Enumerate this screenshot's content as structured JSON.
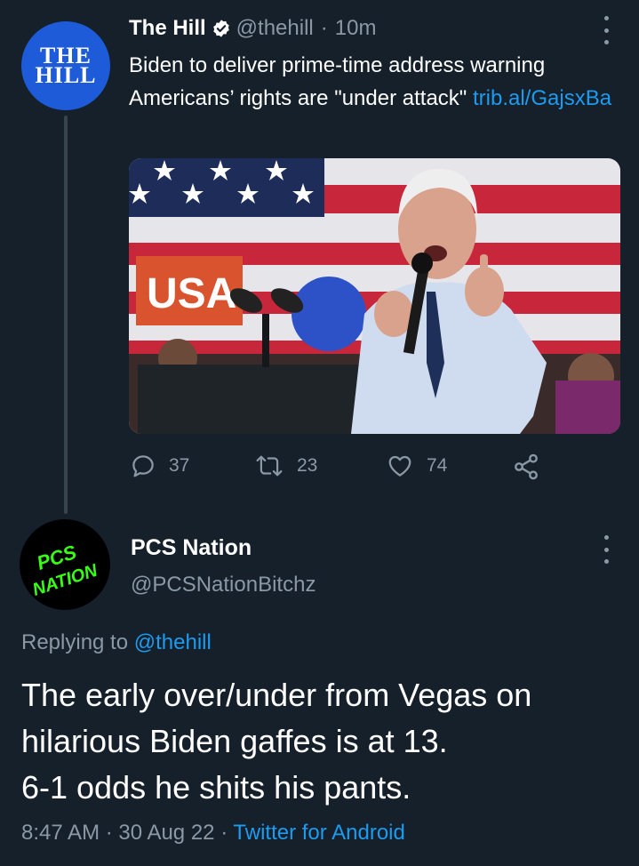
{
  "parent_tweet": {
    "avatar": {
      "line1": "THE",
      "line2": "HILL"
    },
    "author_name": "The Hill",
    "handle": "@thehill",
    "separator": "·",
    "time_ago": "10m",
    "text": "Biden to deliver prime-time address warning Americans’ rights are \"under attack\"",
    "link_text": "trib.al/GajsxBa",
    "media_alt": "Photo of Joe Biden speaking at a podium with an American flag behind him",
    "media_sign_text": "USA",
    "actions": {
      "replies": "37",
      "retweets": "23",
      "likes": "74"
    }
  },
  "reply_tweet": {
    "avatar_text": {
      "line1": "PCS",
      "line2": "NATION"
    },
    "author_name": "PCS Nation",
    "handle": "@PCSNationBitchz",
    "replying_label": "Replying to",
    "replying_handle": "@thehill",
    "body_lines": [
      "The early over/under from Vegas on",
      "hilarious Biden gaffes is at 13.",
      "6-1 odds he shits his pants."
    ],
    "time": "8:47 AM",
    "date": "30 Aug 22",
    "dot": "·",
    "source": "Twitter for Android"
  },
  "colors": {
    "background": "#15202b",
    "text": "#ffffff",
    "muted": "#8b98a5",
    "link": "#1d9bf0",
    "hill_blue": "#1d5bd8",
    "pcs_green": "#39ff14"
  },
  "icons": [
    "verified-badge-icon",
    "more-options-icon",
    "reply-icon",
    "retweet-icon",
    "like-icon",
    "share-icon"
  ]
}
